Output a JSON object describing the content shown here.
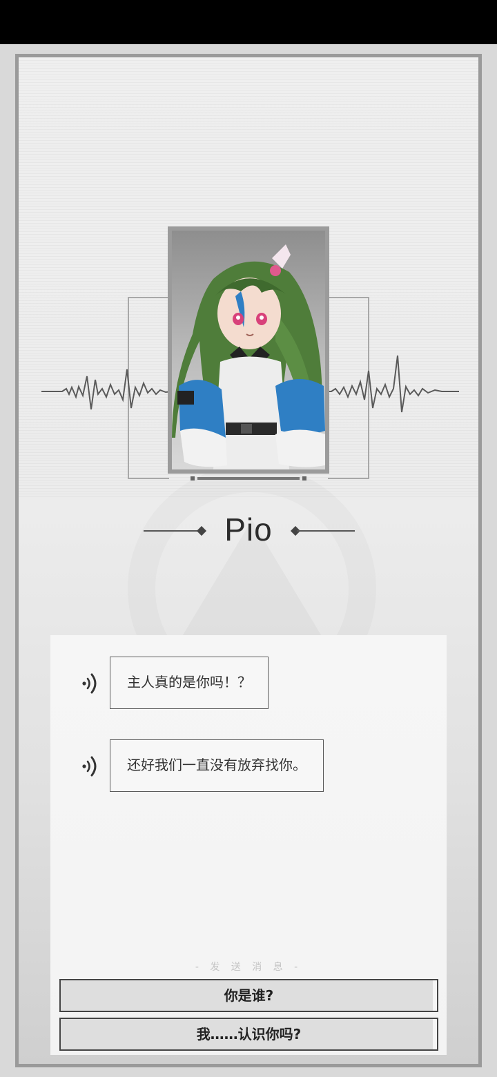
{
  "character": {
    "name": "Pio"
  },
  "messages": [
    {
      "text": "主人真的是你吗！？",
      "icon": "voice-icon"
    },
    {
      "text": "还好我们一直没有放弃找你。",
      "icon": "voice-icon"
    }
  ],
  "send_label": "- 发 送 消 息 -",
  "replies": [
    {
      "label": "你是谁?"
    },
    {
      "label": "我……认识你吗?"
    }
  ],
  "colors": {
    "status_bar": "#000000",
    "frame_border": "#9a9a9a",
    "hair": "#4f7d3a",
    "jacket_accent": "#2f7fc4"
  }
}
